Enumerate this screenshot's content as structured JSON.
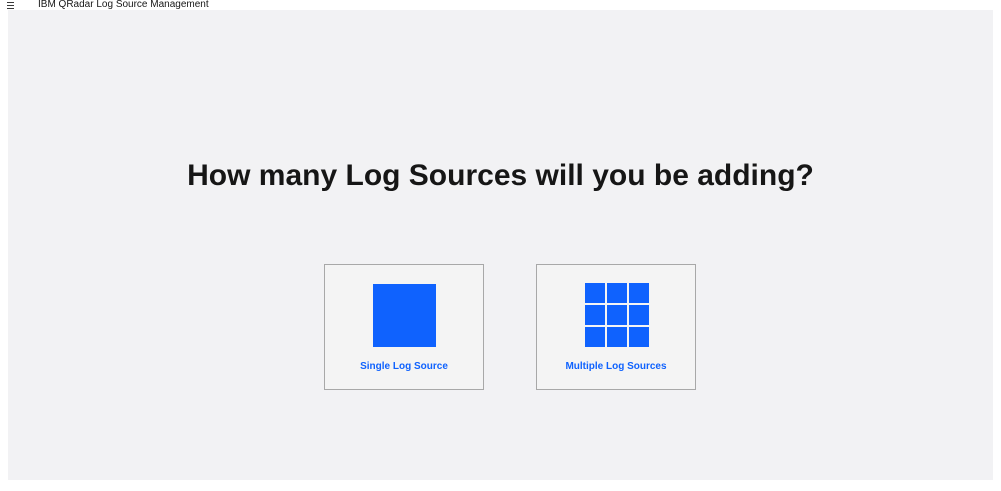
{
  "header": {
    "title": "IBM QRadar Log Source Management",
    "menu_icon": "hamburger-menu-icon"
  },
  "main": {
    "question": "How many Log Sources will you be adding?",
    "options": [
      {
        "label": "Single Log Source",
        "icon": "single-square-icon"
      },
      {
        "label": "Multiple Log Sources",
        "icon": "grid-squares-icon"
      }
    ]
  },
  "colors": {
    "accent": "#0f62fe",
    "background": "#f2f2f4",
    "text": "#161616"
  }
}
